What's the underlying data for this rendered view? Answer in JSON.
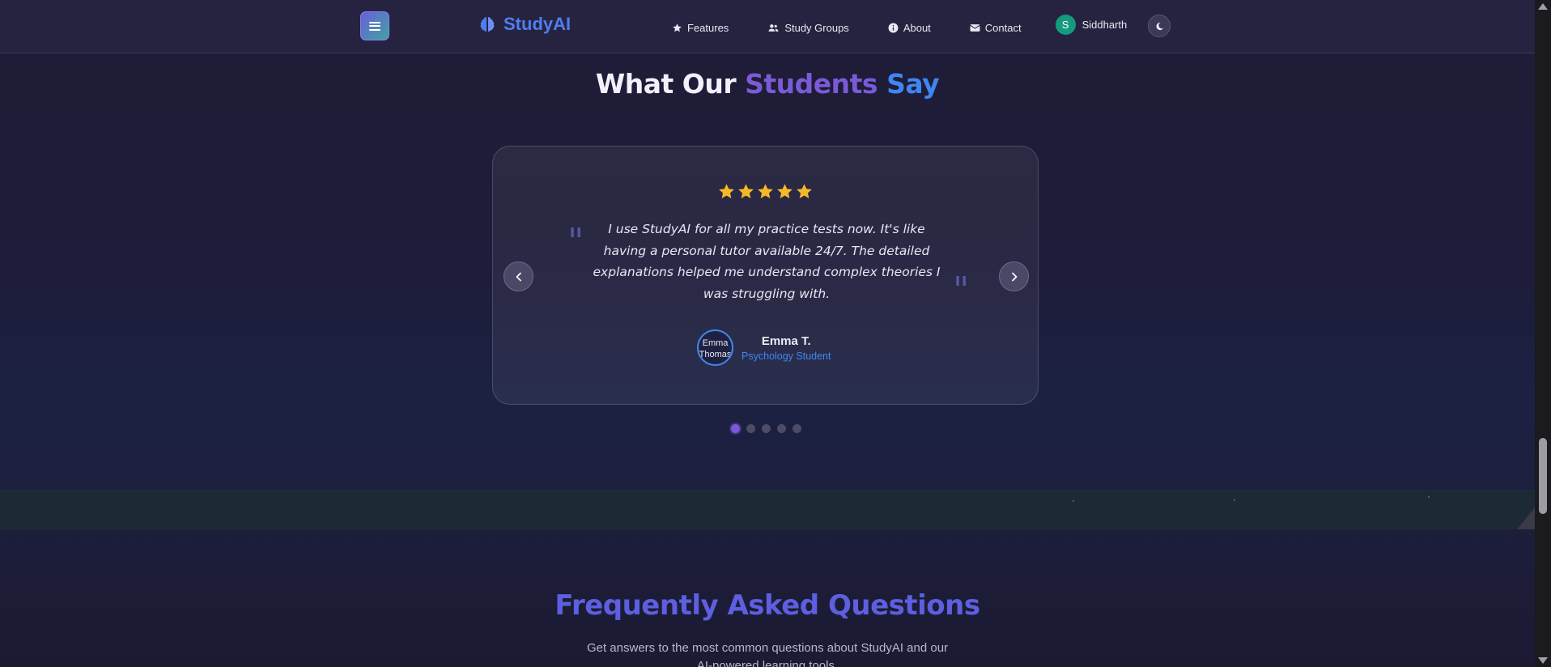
{
  "navbar": {
    "brand": "StudyAI",
    "links": {
      "features": "Features",
      "study_groups": "Study Groups",
      "about": "About",
      "contact": "Contact"
    },
    "user": {
      "initial": "S",
      "name": "Siddharth"
    }
  },
  "testimonials": {
    "title_part1": "What Our",
    "title_part2": "Students",
    "title_part3": "Say",
    "rating": 5,
    "quote": "I use StudyAI for all my practice tests now. It's like having a personal tutor available 24/7. The detailed explanations helped me understand complex theories I was struggling with.",
    "author_name": "Emma T.",
    "author_role": "Psychology Student",
    "avatar_alt": "Emma Thomas",
    "slide_count": 5,
    "active_slide": 1
  },
  "faq": {
    "title": "Frequently Asked Questions",
    "subtitle": "Get answers to the most common questions about StudyAI and our AI-powered learning tools."
  },
  "colors": {
    "accent_purple": "#7a5ad8",
    "accent_blue": "#3f86f2",
    "star_gold": "#f5b82a"
  }
}
